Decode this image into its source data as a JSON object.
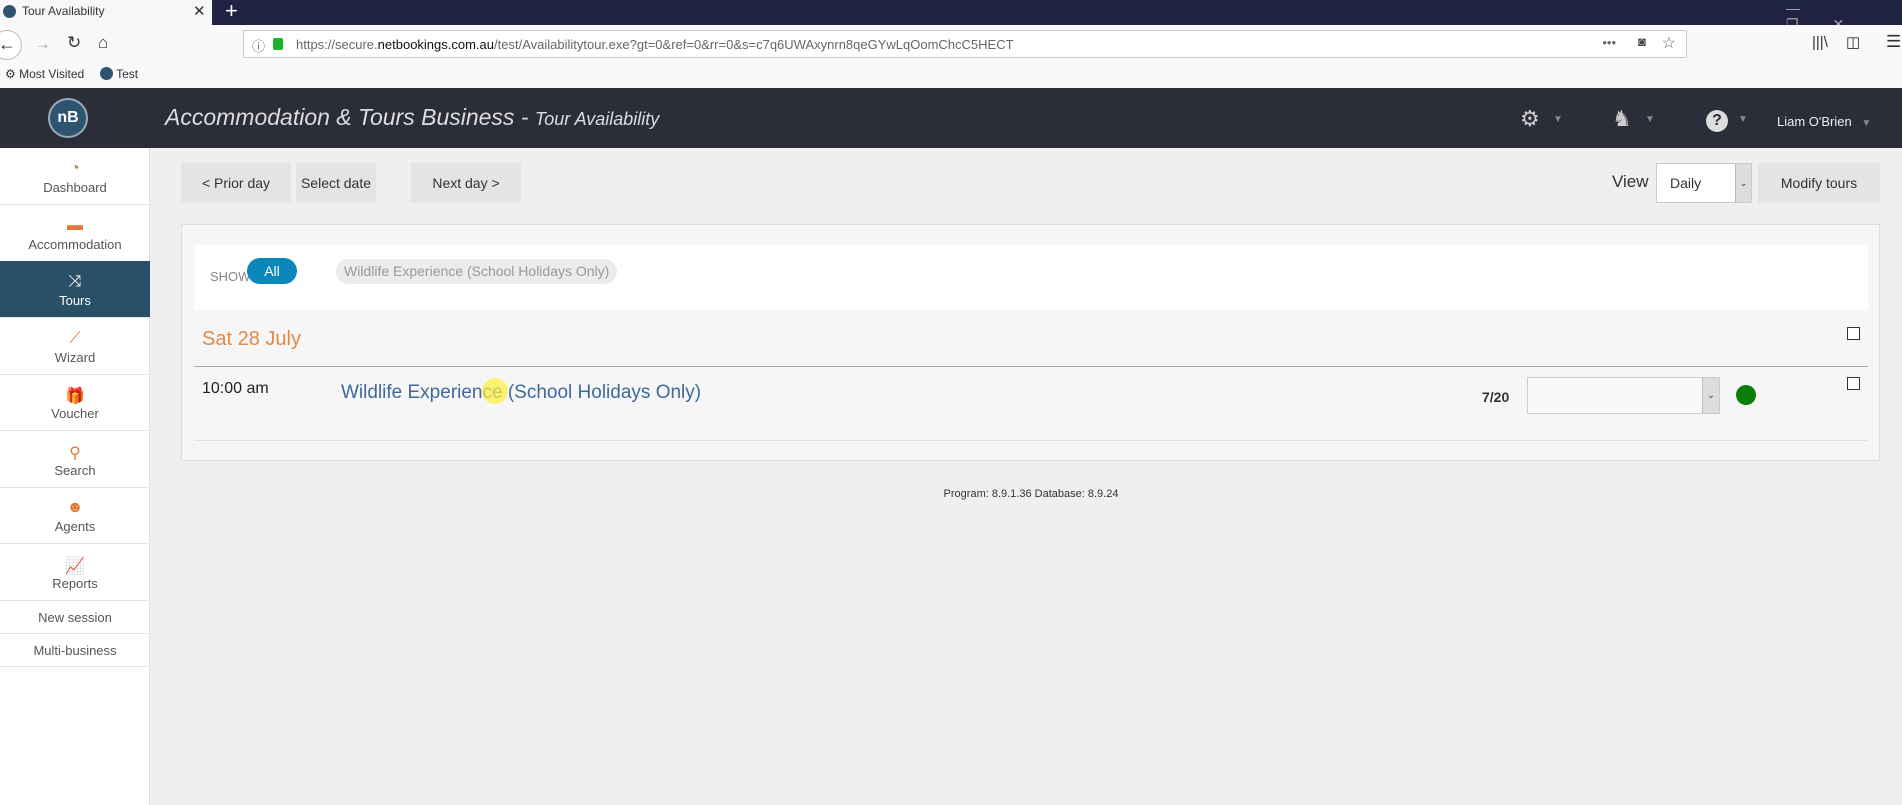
{
  "browser": {
    "tab_title": "Tour Availability",
    "url_prefix": "https://secure.",
    "url_domain": "netbookings.com.au",
    "url_path": "/test/Availabilitytour.exe?gt=0&ref=0&rr=0&s=c7q6UWAxynrn8qeGYwLqOomChcC5HECT",
    "bookmarks": [
      "Most Visited",
      "Test"
    ]
  },
  "header": {
    "logo": "nB",
    "title": "Accommodation & Tours Business - ",
    "subtitle": "Tour Availability",
    "user": "Liam O'Brien",
    "icons": [
      "gear-icon",
      "user-icon",
      "help-icon"
    ]
  },
  "sidebar": {
    "items": [
      {
        "label": "Dashboard",
        "icon": "◔"
      },
      {
        "label": "Accommodation",
        "icon": "▬"
      },
      {
        "label": "Tours",
        "icon": "⤨"
      },
      {
        "label": "Wizard",
        "icon": "⟋"
      },
      {
        "label": "Voucher",
        "icon": "🎁"
      },
      {
        "label": "Search",
        "icon": "⚲"
      },
      {
        "label": "Agents",
        "icon": "☻"
      },
      {
        "label": "Reports",
        "icon": "📈"
      }
    ],
    "links": [
      "New session",
      "Multi-business"
    ]
  },
  "toolbar": {
    "prior": "< Prior day",
    "select": "Select date",
    "next": "Next day >",
    "view_label": "View",
    "view_value": "Daily",
    "modify": "Modify tours"
  },
  "filter": {
    "label": "SHOW:",
    "all": "All",
    "tour": "Wildlife Experience (School Holidays Only)"
  },
  "day": {
    "date": "Sat 28 July",
    "rows": [
      {
        "time": "10:00 am",
        "tour": "Wildlife Experience (School Holidays Only)",
        "availability": "7/20",
        "status_color": "#0a7d0a"
      }
    ]
  },
  "footer": "Program: 8.9.1.36 Database: 8.9.24",
  "colors": {
    "accent": "#e08a4a",
    "active": "#2a5068",
    "pill": "#0a88bb",
    "link": "#3d6a9a"
  }
}
